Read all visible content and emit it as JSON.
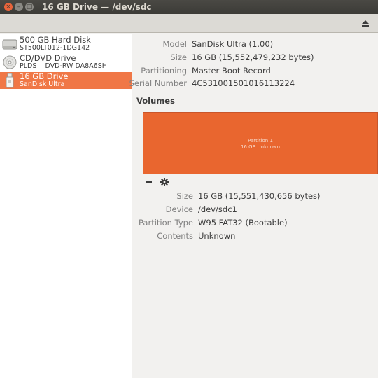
{
  "window": {
    "title": "16 GB Drive — /dev/sdc",
    "close_glyph": "×",
    "minimize_glyph": "–",
    "maximize_glyph": "□"
  },
  "toolbar": {
    "eject_icon": "eject-icon"
  },
  "sidebar": {
    "devices": [
      {
        "name": "500 GB Hard Disk",
        "subtitle": "ST500LT012-1DG142",
        "icon": "hard-disk-icon",
        "selected": false
      },
      {
        "name": "CD/DVD Drive",
        "subtitle": "PLDS    DVD-RW DA8A6SH",
        "icon": "optical-drive-icon",
        "selected": false
      },
      {
        "name": "16 GB Drive",
        "subtitle": "SanDisk Ultra",
        "icon": "usb-drive-icon",
        "selected": true
      }
    ]
  },
  "drive": {
    "model_label": "Model",
    "model": "SanDisk Ultra (1.00)",
    "size_label": "Size",
    "size": "16 GB (15,552,479,232 bytes)",
    "partitioning_label": "Partitioning",
    "partitioning": "Master Boot Record",
    "serial_label": "Serial Number",
    "serial": "4C531001501016113224"
  },
  "volumes": {
    "heading": "Volumes",
    "partition_title": "Partition 1",
    "partition_subtitle": "16 GB Unknown",
    "color": "#e9662f",
    "size_label": "Size",
    "size": "16 GB (15,551,430,656 bytes)",
    "device_label": "Device",
    "device": "/dev/sdc1",
    "type_label": "Partition Type",
    "type": "W95 FAT32 (Bootable)",
    "contents_label": "Contents",
    "contents": "Unknown"
  }
}
